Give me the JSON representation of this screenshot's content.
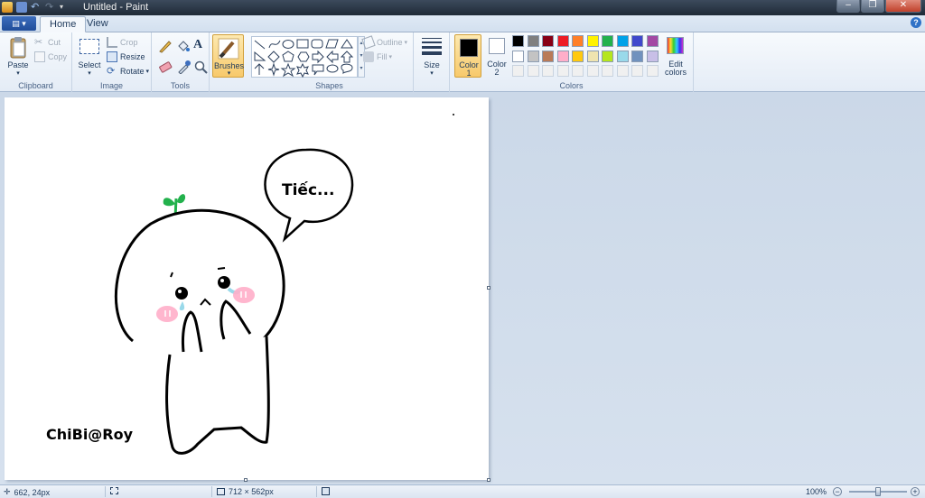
{
  "window": {
    "title": "Untitled - Paint",
    "controls": {
      "minimize": "–",
      "maximize": "❐",
      "close": "✕"
    }
  },
  "tabs": [
    {
      "label": "Home",
      "active": true
    },
    {
      "label": "View",
      "active": false
    }
  ],
  "ribbon": {
    "clipboard": {
      "paste": "Paste",
      "cut": "Cut",
      "copy": "Copy",
      "group_label": "Clipboard"
    },
    "image": {
      "select": "Select",
      "crop": "Crop",
      "resize": "Resize",
      "rotate": "Rotate",
      "group_label": "Image"
    },
    "tools": {
      "group_label": "Tools",
      "text_tool": "A"
    },
    "brushes": {
      "label": "Brushes"
    },
    "shapes": {
      "outline": "Outline",
      "fill": "Fill",
      "group_label": "Shapes"
    },
    "size": {
      "label": "Size"
    },
    "colors": {
      "color1_label": "Color",
      "color1_num": "1",
      "color2_label": "Color",
      "color2_num": "2",
      "edit_label": "Edit",
      "edit_label2": "colors",
      "group_label": "Colors",
      "color1": "#000000",
      "color2": "#ffffff",
      "palette_row1": [
        "#000000",
        "#7f7f7f",
        "#880015",
        "#ed1c24",
        "#ff7f27",
        "#fff200",
        "#22b14c",
        "#00a2e8",
        "#3f48cc",
        "#a349a4"
      ],
      "palette_row2": [
        "#ffffff",
        "#c3c3c3",
        "#b97a57",
        "#ffaec9",
        "#ffc90e",
        "#efe4b0",
        "#b5e61d",
        "#99d9ea",
        "#7092be",
        "#c8bfe7"
      ],
      "palette_row3": [
        "#f0f0f0",
        "#f0f0f0",
        "#f0f0f0",
        "#f0f0f0",
        "#f0f0f0",
        "#f0f0f0",
        "#f0f0f0",
        "#f0f0f0",
        "#f0f0f0",
        "#f0f0f0"
      ]
    }
  },
  "canvas": {
    "speech_text": "Tiếc...",
    "signature": "ChiBi@Roy"
  },
  "statusbar": {
    "cursor_pos": "662, 24px",
    "image_size": "712 × 562px",
    "zoom": "100%",
    "zoom_fraction": 0.5
  }
}
